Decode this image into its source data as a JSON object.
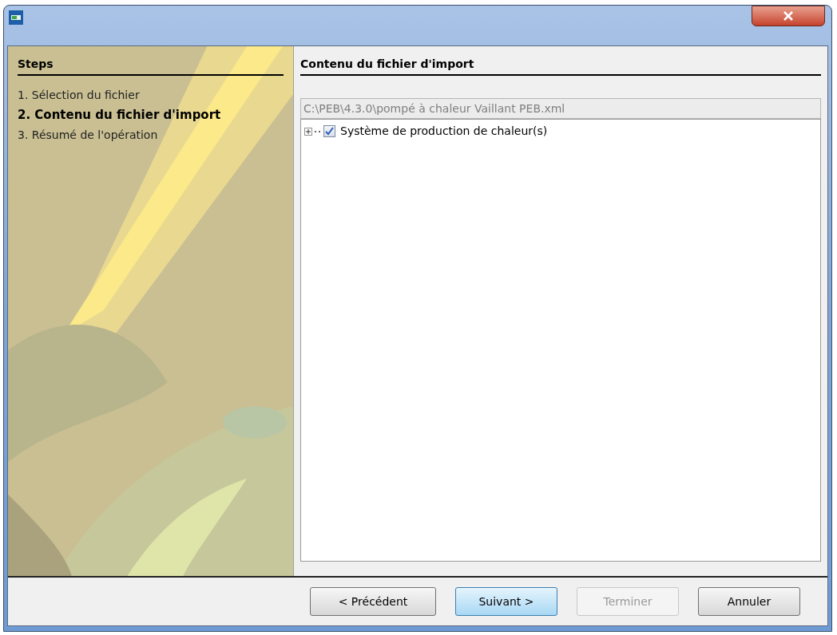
{
  "steps": {
    "title": "Steps",
    "items": [
      {
        "label": "1. Sélection du fichier",
        "selected": false
      },
      {
        "label": "2. Contenu du fichier d'import",
        "selected": true
      },
      {
        "label": "3. Résumé de l'opération",
        "selected": false
      }
    ]
  },
  "content": {
    "title": "Contenu du fichier d'import",
    "path_field": {
      "value": "C:\\PEB\\4.3.0\\pompé à chaleur Vaillant PEB.xml",
      "disabled": true
    },
    "tree": [
      {
        "label": "Système de production de chaleur(s)",
        "checked": true,
        "expanded": false
      }
    ]
  },
  "buttons": [
    {
      "label": "< Précédent",
      "disabled": false,
      "selected": false
    },
    {
      "label": "Suivant >",
      "disabled": false,
      "selected": true
    },
    {
      "label": "Terminer",
      "disabled": true,
      "selected": false
    },
    {
      "label": "Annuler",
      "disabled": false,
      "selected": false
    }
  ]
}
